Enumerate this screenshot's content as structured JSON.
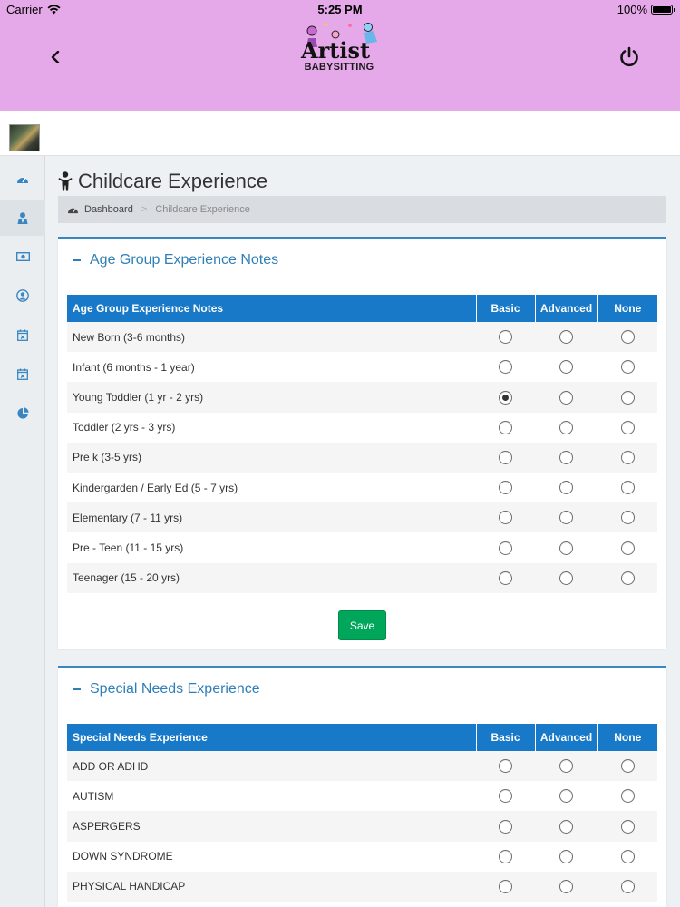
{
  "status_bar": {
    "carrier": "Carrier",
    "time": "5:25 PM",
    "battery": "100%",
    "battery_level": 1.0
  },
  "header": {
    "logo_text": "Artist",
    "logo_subtext": "BABYSITTING",
    "colors": {
      "background": "#e5a8e8",
      "primary": "#1879c8",
      "save": "#00a65a"
    }
  },
  "sidebar": {
    "items": [
      {
        "icon": "dashboard-icon"
      },
      {
        "icon": "user-tie-icon",
        "active": true
      },
      {
        "icon": "money-icon"
      },
      {
        "icon": "user-circle-icon"
      },
      {
        "icon": "calendar-times-icon"
      },
      {
        "icon": "calendar-times-icon"
      },
      {
        "icon": "pie-chart-icon"
      }
    ]
  },
  "page": {
    "title": "Childcare Experience",
    "breadcrumb": {
      "home": "Dashboard",
      "separator": ">",
      "current": "Childcare Experience"
    }
  },
  "age_group": {
    "card_title": "Age Group Experience Notes",
    "columns": [
      "Age Group Experience Notes",
      "Basic",
      "Advanced",
      "None"
    ],
    "rows": [
      {
        "label": "New Born (3-6 months)",
        "selected": ""
      },
      {
        "label": "Infant (6 months - 1 year)",
        "selected": ""
      },
      {
        "label": "Young Toddler (1 yr - 2 yrs)",
        "selected": "Basic"
      },
      {
        "label": "Toddler (2 yrs - 3 yrs)",
        "selected": ""
      },
      {
        "label": "Pre k (3-5 yrs)",
        "selected": ""
      },
      {
        "label": "Kindergarden / Early Ed (5 - 7 yrs)",
        "selected": ""
      },
      {
        "label": "Elementary (7 - 11 yrs)",
        "selected": ""
      },
      {
        "label": "Pre - Teen (11 - 15 yrs)",
        "selected": ""
      },
      {
        "label": "Teenager (15 - 20 yrs)",
        "selected": ""
      }
    ],
    "save_label": "Save"
  },
  "special_needs": {
    "card_title": "Special Needs Experience",
    "columns": [
      "Special Needs Experience",
      "Basic",
      "Advanced",
      "None"
    ],
    "rows": [
      {
        "label": "ADD OR ADHD",
        "selected": ""
      },
      {
        "label": "AUTISM",
        "selected": ""
      },
      {
        "label": "ASPERGERS",
        "selected": ""
      },
      {
        "label": "DOWN SYNDROME",
        "selected": ""
      },
      {
        "label": "PHYSICAL HANDICAP",
        "selected": ""
      }
    ]
  }
}
